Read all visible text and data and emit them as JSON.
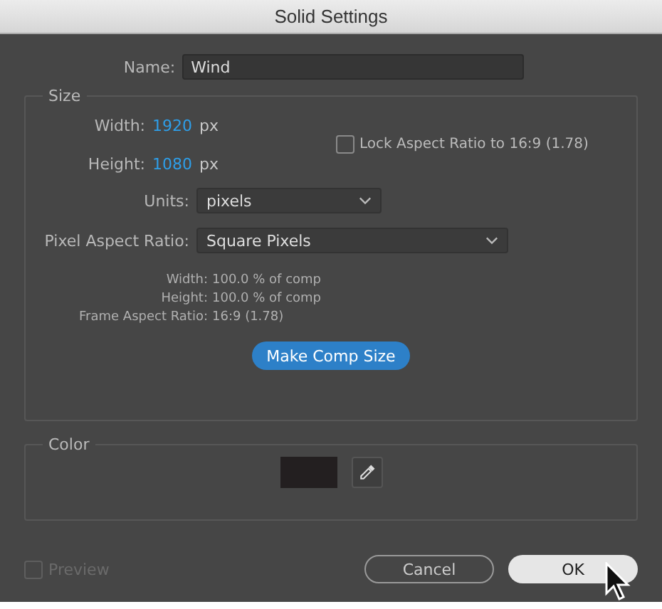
{
  "window": {
    "title": "Solid Settings"
  },
  "name_field": {
    "label": "Name:",
    "value": "Wind"
  },
  "size": {
    "title": "Size",
    "width": {
      "label": "Width:",
      "value": "1920",
      "unit": "px"
    },
    "height": {
      "label": "Height:",
      "value": "1080",
      "unit": "px"
    },
    "lock_aspect": {
      "label": "Lock Aspect Ratio to 16:9 (1.78)",
      "checked": false
    },
    "units": {
      "label": "Units:",
      "value": "pixels"
    },
    "pixel_aspect": {
      "label": "Pixel Aspect Ratio:",
      "value": "Square Pixels"
    },
    "info": [
      {
        "label": "Width:",
        "value": "100.0 % of comp"
      },
      {
        "label": "Height:",
        "value": "100.0 % of comp"
      },
      {
        "label": "Frame Aspect Ratio:",
        "value": "16:9 (1.78)"
      }
    ],
    "button": "Make Comp Size"
  },
  "color": {
    "title": "Color",
    "swatch": {
      "color": "#231f20"
    }
  },
  "preview": {
    "label": "Preview",
    "checked": false,
    "disabled": true
  },
  "buttons": [
    {
      "label": "Cancel",
      "kind": "secondary"
    },
    {
      "label": "OK",
      "kind": "primary"
    }
  ]
}
